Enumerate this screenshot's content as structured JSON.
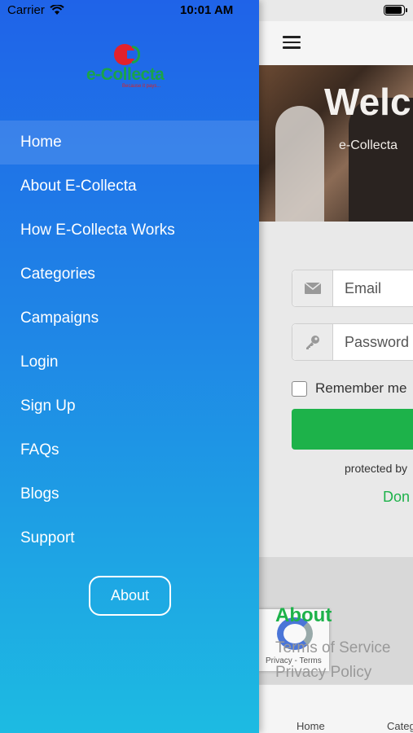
{
  "status_bar": {
    "carrier": "Carrier",
    "time": "10:01 AM"
  },
  "brand": {
    "name": "e-Collecta",
    "tagline": "Because it pays...",
    "red": "#e3212b",
    "green": "#1aa34a"
  },
  "drawer": {
    "gradient_top": "#1f63e8",
    "gradient_bottom": "#1dbbe2",
    "items": [
      {
        "label": "Home",
        "active": true
      },
      {
        "label": "About E-Collecta"
      },
      {
        "label": "How E-Collecta Works"
      },
      {
        "label": "Categories"
      },
      {
        "label": "Campaigns"
      },
      {
        "label": "Login"
      },
      {
        "label": "Sign Up"
      },
      {
        "label": "FAQs"
      },
      {
        "label": "Blogs"
      },
      {
        "label": "Support"
      }
    ],
    "about_button": "About"
  },
  "hero": {
    "title": "Welc",
    "subtitle": "e-Collecta"
  },
  "login_form": {
    "email_placeholder": "Email",
    "password_placeholder": "Password",
    "remember_label": "Remember me",
    "protected_text": "protected by",
    "donate_text": "Don",
    "accent": "#1db24a"
  },
  "footer": {
    "about_heading": "About",
    "links": [
      "Terms of Service",
      "Privacy Policy"
    ],
    "recaptcha_links": "Privacy - Terms"
  },
  "tab_bar": {
    "tabs": [
      "Home",
      "Categ"
    ]
  }
}
